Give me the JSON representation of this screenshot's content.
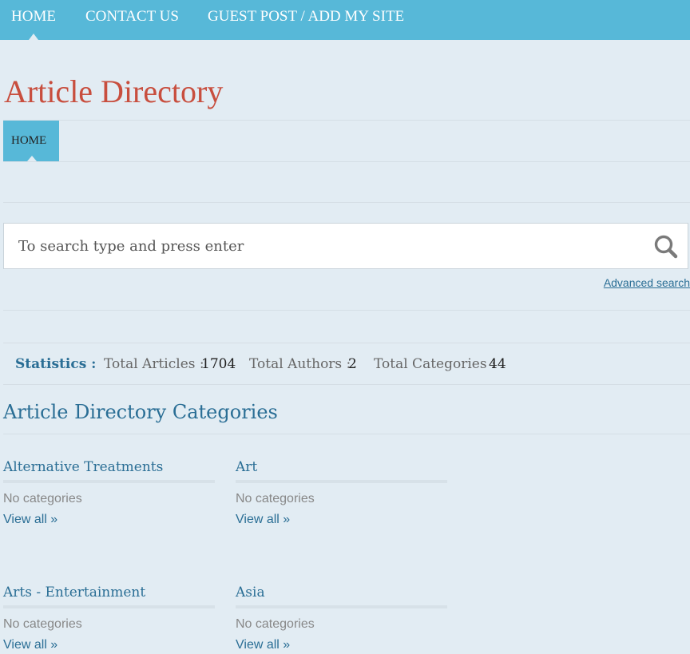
{
  "top_nav": {
    "items": [
      {
        "label": "HOME"
      },
      {
        "label": "CONTACT US"
      },
      {
        "label": "GUEST POST / ADD MY SITE"
      }
    ]
  },
  "site": {
    "title": "Article Directory"
  },
  "sub_nav": {
    "home_label": "HOME"
  },
  "search": {
    "placeholder": "To search type and press enter",
    "advanced_label": "Advanced search"
  },
  "stats": {
    "label": "Statistics :",
    "articles_key": "Total Articles :",
    "articles_val": "1704",
    "authors_key": "Total Authors :",
    "authors_val": "2",
    "categories_key": "Total Categories :",
    "categories_val": "44"
  },
  "categories": {
    "heading": "Article Directory Categories",
    "items": [
      {
        "title": "Alternative Treatments",
        "sub": "No categories",
        "view": "View all »"
      },
      {
        "title": "Art",
        "sub": "No categories",
        "view": "View all »"
      },
      {
        "title": "Arts - Entertainment",
        "sub": "No categories",
        "view": "View all »"
      },
      {
        "title": "Asia",
        "sub": "No categories",
        "view": "View all »"
      }
    ]
  },
  "colors": {
    "nav_bg": "#57b8d8",
    "page_bg": "#e2ecf3",
    "title_red": "#c84e3e",
    "link_blue": "#2a6e95"
  }
}
